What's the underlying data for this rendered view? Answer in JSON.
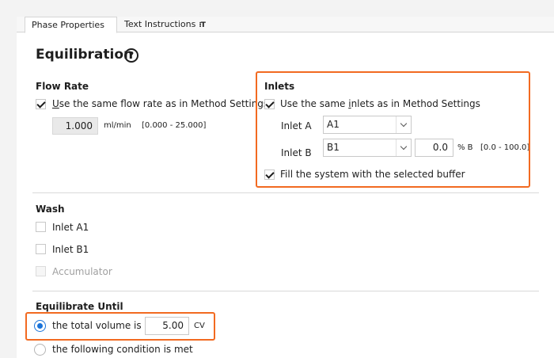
{
  "tabs": [
    {
      "label": "Phase Properties"
    },
    {
      "label": "Text Instructions"
    }
  ],
  "page_title": "Equilibration",
  "help_glyph": "?",
  "flow_rate": {
    "heading": "Flow Rate",
    "same_flow_pre": "U",
    "same_flow_rest": "se the same flow rate as in Method Settings",
    "value": "1.000",
    "unit": "ml/min",
    "range": "[0.000 - 25.000]"
  },
  "inlets": {
    "heading": "Inlets",
    "same_inlets_pre": "Use the same ",
    "same_inlets_u": "i",
    "same_inlets_rest": "nlets as in Method Settings",
    "inlet_a_label": "Inlet A",
    "inlet_a_value": "A1",
    "inlet_b_label": "Inlet B",
    "inlet_b_value": "B1",
    "percent_b_value": "0.0",
    "percent_b_unit": "% B",
    "percent_b_range": "[0.0 - 100.0]",
    "fill_label": "Fill the system with the selected buffer"
  },
  "wash": {
    "heading": "Wash",
    "items": [
      {
        "label": "Inlet A1"
      },
      {
        "label": "Inlet B1"
      },
      {
        "label": "Accumulator"
      }
    ]
  },
  "equilibrate_until": {
    "heading": "Equilibrate Until",
    "option_volume_label": "the total volume is",
    "volume_value": "5.00",
    "volume_unit": "CV",
    "option_condition_label": "the following condition is met"
  },
  "colors": {
    "highlight": "#f26a21",
    "radio_accent": "#1a73d9"
  }
}
